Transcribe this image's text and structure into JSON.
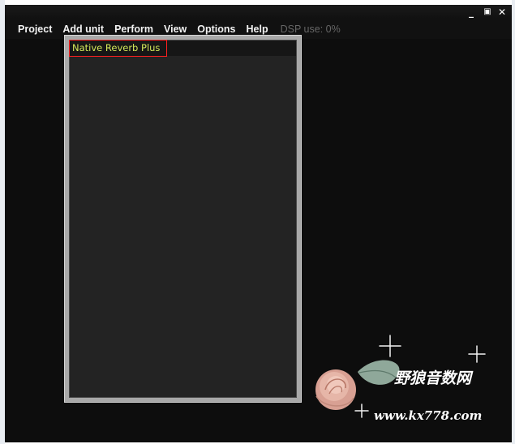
{
  "window": {
    "minimize_glyph": "_",
    "maximize_glyph": "▣",
    "close_glyph": "✕"
  },
  "menubar": {
    "items": [
      "Project",
      "Add unit",
      "Perform",
      "View",
      "Options",
      "Help"
    ],
    "dsp_status": "DSP use: 0%"
  },
  "unit_panel": {
    "title": "Native Reverb Plus"
  },
  "watermark": {
    "site_name": "野狼音数网",
    "url": "www.kx778.com"
  },
  "colors": {
    "app_background": "#0d0d0d",
    "panel_border": "#a8a8a8",
    "panel_background": "#232323",
    "unit_title_text": "#d4e85a",
    "selection_outline": "#ff2020"
  }
}
